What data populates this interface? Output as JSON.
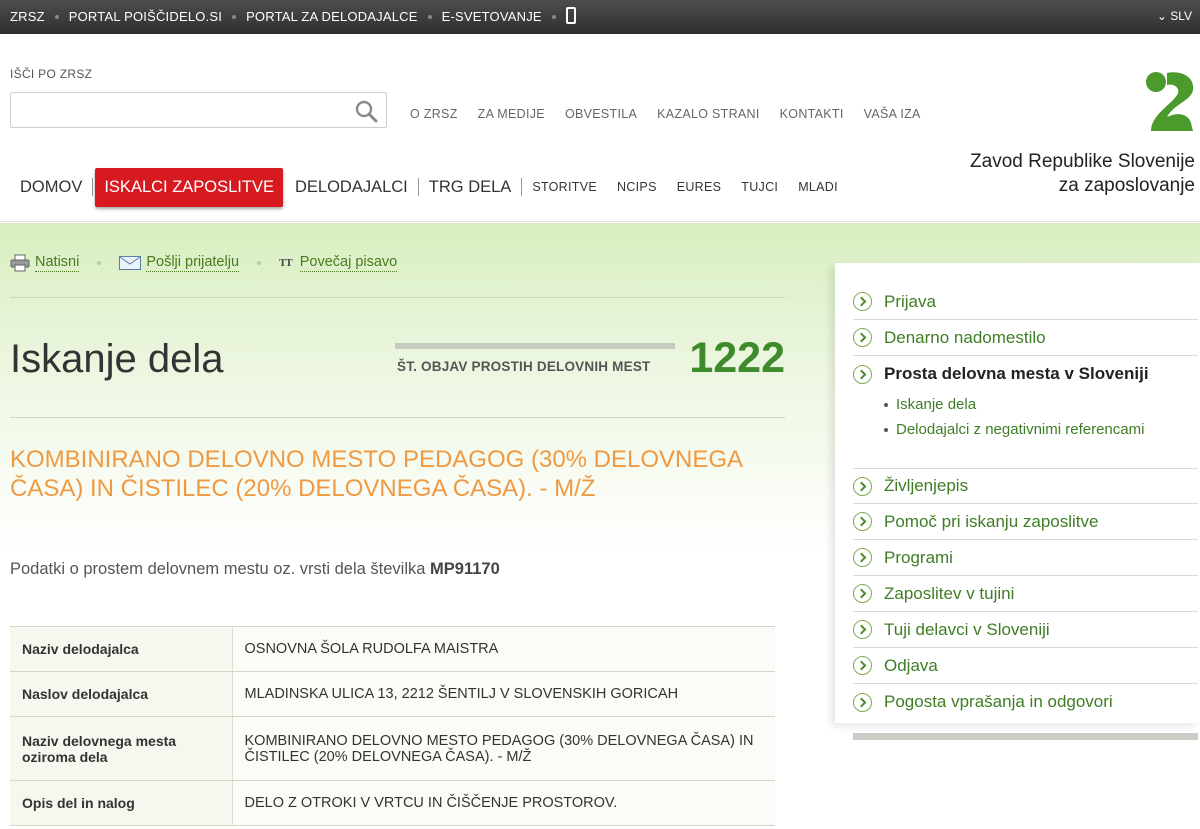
{
  "topbar": {
    "links": [
      "ZRSZ",
      "PORTAL POIŠČIDELO.SI",
      "PORTAL ZA DELODAJALCE",
      "E-SVETOVANJE"
    ],
    "mobile_icon": "mobile-phone-icon",
    "language": "⌄ SLV"
  },
  "header": {
    "search_label": "IŠČI PO ZRSZ",
    "search_value": "",
    "search_icon": "search-icon",
    "util_nav": [
      "O ZRSZ",
      "ZA MEDIJE",
      "OBVESTILA",
      "KAZALO STRANI",
      "KONTAKTI",
      "VAŠA IZA"
    ],
    "org_name_line1": "Zavod Republike Slovenije",
    "org_name_line2": "za zaposlovanje",
    "main_nav": {
      "home": "DOMOV",
      "job_seekers": "ISKALCI ZAPOSLITVE",
      "employers": "DELODAJALCI",
      "labour_market": "TRG DELA",
      "services": "STORITVE",
      "ncips": "NCIPS",
      "eures": "EURES",
      "foreigners": "TUJCI",
      "youth": "MLADI"
    }
  },
  "tools": {
    "print": "Natisni",
    "send_friend": "Pošlji prijatelju",
    "font_size": "Povečaj pisavo",
    "font_size_glyph": "TT"
  },
  "main": {
    "title": "Iskanje dela",
    "count_label": "ŠT. OBJAV PROSTIH DELOVNIH MEST",
    "count_value": "1222",
    "job_title": "KOMBINIRANO DELOVNO MESTO PEDAGOG (30% DELOVNEGA ČASA) IN ČISTILEC (20% DELOVNEGA ČASA). - M/Ž",
    "ref_text": "Podatki o prostem delovnem mestu oz. vrsti dela številka",
    "ref_number": "MP91170",
    "details": [
      {
        "key": "Naziv delodajalca",
        "value": "OSNOVNA ŠOLA RUDOLFA MAISTRA"
      },
      {
        "key": "Naslov delodajalca",
        "value": "MLADINSKA ULICA 13, 2212 ŠENTILJ V SLOVENSKIH GORICAH"
      },
      {
        "key": "Naziv delovnega mesta oziroma dela",
        "value": "KOMBINIRANO DELOVNO MESTO PEDAGOG (30% DELOVNEGA ČASA) IN ČISTILEC (20% DELOVNEGA ČASA). - M/Ž"
      },
      {
        "key": "Opis del in nalog",
        "value": "DELO Z OTROKI V VRTCU IN ČIŠČENJE PROSTOROV."
      }
    ]
  },
  "sidebar": {
    "items": [
      "Prijava",
      "Denarno nadomestilo",
      "Prosta delovna mesta v Sloveniji",
      "Življenjepis",
      "Pomoč pri iskanju zaposlitve",
      "Programi",
      "Zaposlitev v tujini",
      "Tuji delavci v Sloveniji",
      "Odjava",
      "Pogosta vprašanja in odgovori"
    ],
    "sub_items": [
      "Iskanje dela",
      "Delodajalci z negativnimi referencami"
    ]
  },
  "colors": {
    "accent_red": "#d71920",
    "green_link": "#3f7d26",
    "count_green": "#3d8b2a",
    "job_title_orange": "#ef9a42"
  }
}
